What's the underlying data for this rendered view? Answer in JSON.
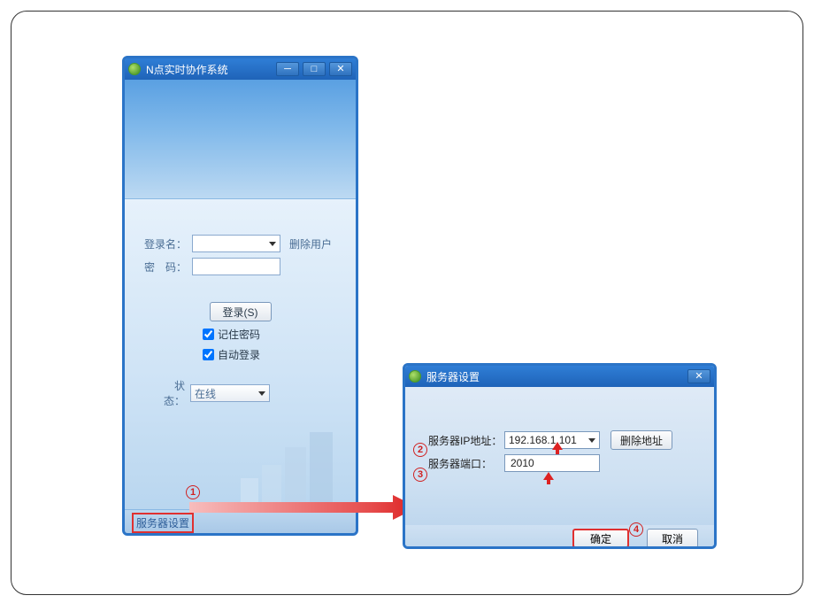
{
  "login": {
    "title": "N点实时协作系统",
    "username_label": "登录名：",
    "password_label": "密　码：",
    "delete_user": "删除用户",
    "login_button": "登录(S)",
    "remember_password": "记住密码",
    "auto_login": "自动登录",
    "status_label": "状　态：",
    "status_value": "在线",
    "server_settings_link": "服务器设置"
  },
  "settings": {
    "title": "服务器设置",
    "ip_label": "服务器IP地址：",
    "ip_value": "192.168.1.101",
    "delete_address": "删除地址",
    "port_label": "服务器端口：",
    "port_value": "2010",
    "ok": "确定",
    "cancel": "取消"
  },
  "annotations": {
    "n1": "1",
    "n2": "2",
    "n3": "3",
    "n4": "4"
  }
}
